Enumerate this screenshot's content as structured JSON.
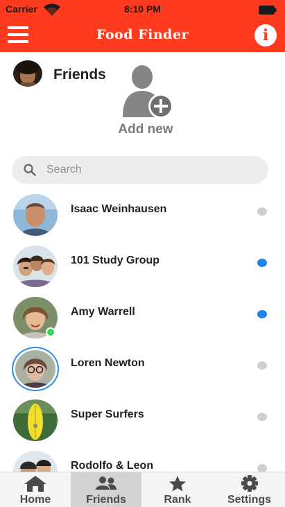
{
  "status_bar": {
    "carrier": "Carrier",
    "time": "8:10 PM"
  },
  "header": {
    "title": "Food Finder",
    "menu_icon": "hamburger-icon",
    "info_icon": "info-icon",
    "info_glyph": "i",
    "brand_color": "#fe3b1f"
  },
  "page": {
    "title": "Friends"
  },
  "add_new": {
    "label": "Add new",
    "icon": "add-person-icon"
  },
  "search": {
    "placeholder": "Search",
    "value": ""
  },
  "friends": [
    {
      "name": "Isaac Weinhausen",
      "selected": false,
      "online": false
    },
    {
      "name": "101 Study Group",
      "selected": true,
      "online": false
    },
    {
      "name": "Amy Warrell",
      "selected": true,
      "online": true
    },
    {
      "name": "Loren Newton",
      "selected": false,
      "online": false,
      "highlighted": true
    },
    {
      "name": "Super Surfers",
      "selected": false,
      "online": false
    },
    {
      "name": "Rodolfo & Leon",
      "selected": false,
      "online": false
    }
  ],
  "tabs": [
    {
      "label": "Home",
      "icon": "home-icon",
      "active": false
    },
    {
      "label": "Friends",
      "icon": "friends-icon",
      "active": true
    },
    {
      "label": "Rank",
      "icon": "star-icon",
      "active": false
    },
    {
      "label": "Settings",
      "icon": "gear-icon",
      "active": false
    }
  ],
  "colors": {
    "accent": "#1a85ea",
    "online": "#3fd35b"
  }
}
